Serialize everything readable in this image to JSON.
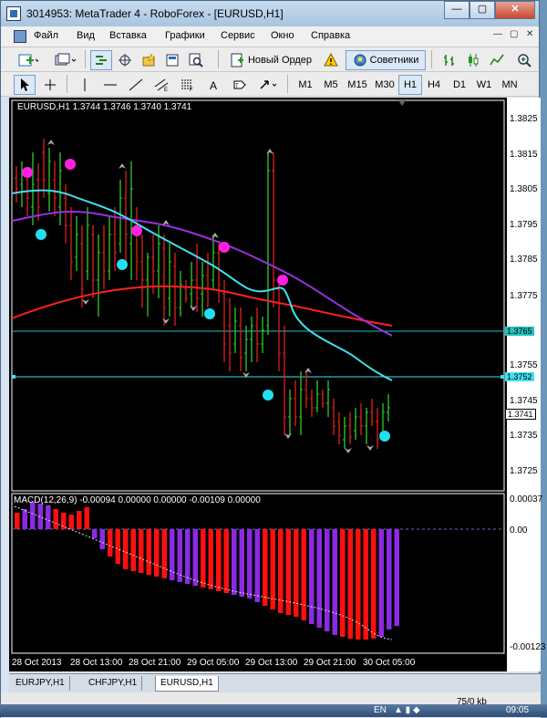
{
  "window": {
    "title": "3014953: MetaTrader 4 - RoboForex - [EURUSD,H1]",
    "min": "—",
    "max": "▢",
    "close": "✕"
  },
  "menu": {
    "items": [
      "Файл",
      "Вид",
      "Вставка",
      "Графики",
      "Сервис",
      "Окно",
      "Справка"
    ],
    "mdi": [
      "—",
      "▢",
      "✕"
    ]
  },
  "toolbar": {
    "new_order": "Новый Ордер",
    "experts": "Советники"
  },
  "timeframes": [
    "M1",
    "M5",
    "M15",
    "M30",
    "H1",
    "H4",
    "D1",
    "W1",
    "MN"
  ],
  "active_timeframe": "H1",
  "chart": {
    "info": "EURUSD,H1  1.3744 1.3746 1.3740 1.3741",
    "price_levels": [
      "1.3825",
      "1.3815",
      "1.3805",
      "1.3795",
      "1.3785",
      "1.3775",
      "1.3765",
      "1.3755",
      "1.3752",
      "1.3745",
      "1.3741",
      "1.3735",
      "1.3725"
    ],
    "macd_info": "MACD(12,26,9) -0.00094 0.00000 0.00000 -0.00109 0.00000",
    "macd_levels": [
      "0.00037",
      "0.00",
      "-0.00123"
    ],
    "time_labels": [
      "28 Oct 2013",
      "28 Oct 13:00",
      "28 Oct 21:00",
      "29 Oct 05:00",
      "29 Oct 13:00",
      "29 Oct 21:00",
      "30 Oct 05:00"
    ]
  },
  "tabs": [
    "EURJPY,H1",
    "CHFJPY,H1",
    "EURUSD,H1"
  ],
  "active_tab": "EURUSD,H1",
  "status": {
    "kb": "75/0 kb",
    "lang": "EN",
    "clock": "09:05"
  },
  "colors": {
    "bull": "#2ecc2e",
    "bear": "#e02020",
    "ma_fast": "#40e0f0",
    "ma_mid": "#9b30e0",
    "ma_slow": "#ff2020",
    "macd_red": "#ff1010",
    "macd_violet": "#8a2be2",
    "dot_magenta": "#ff20e0",
    "dot_cyan": "#20e0f0"
  }
}
